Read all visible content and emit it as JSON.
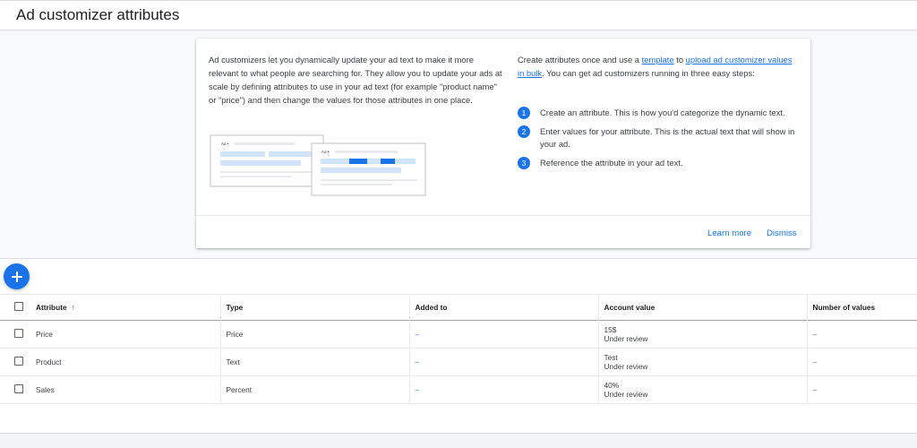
{
  "page": {
    "title": "Ad customizer attributes"
  },
  "info_card": {
    "description": "Ad customizers let you dynamically update your ad text to make it more relevant to what people are searching for. They allow you to update your ads at scale by defining attributes to use in your ad text (for example \"product name\" or \"price\") and then change the values for those attributes in one place.",
    "intro_part1": "Create attributes once and use a ",
    "template_link": "template",
    "intro_part2": " to ",
    "upload_link": "upload ad customizer values in bulk",
    "intro_part3": ". You can get ad customizers running in three easy steps:",
    "steps": [
      {
        "num": "1",
        "text": "Create an attribute. This is how you'd categorize the dynamic text."
      },
      {
        "num": "2",
        "text": "Enter values for your attribute. This is the actual text that will show in your ad."
      },
      {
        "num": "3",
        "text": "Reference the attribute in your ad text."
      }
    ],
    "illustration_label_a": "Ad •",
    "illustration_label_b": "Ad •",
    "learn_more_label": "Learn more",
    "dismiss_label": "Dismiss"
  },
  "table": {
    "columns": {
      "attribute": "Attribute",
      "type": "Type",
      "added_to": "Added to",
      "account_value": "Account value",
      "number_of_values": "Number of values"
    },
    "sort_icon": "↑",
    "rows": [
      {
        "attribute": "Price",
        "type": "Price",
        "added_to": "–",
        "value": "15$",
        "status": "Under review",
        "count": "–"
      },
      {
        "attribute": "Product",
        "type": "Text",
        "added_to": "–",
        "value": "Test",
        "status": "Under review",
        "count": "–"
      },
      {
        "attribute": "Sales",
        "type": "Percent",
        "added_to": "–",
        "value": "40%",
        "status": "Under review",
        "count": "–"
      }
    ]
  },
  "colors": {
    "accent": "#1a73e8",
    "background": "#f1f3f4"
  },
  "icons": {
    "fab": "plus-icon",
    "sort": "arrow-up-icon"
  }
}
